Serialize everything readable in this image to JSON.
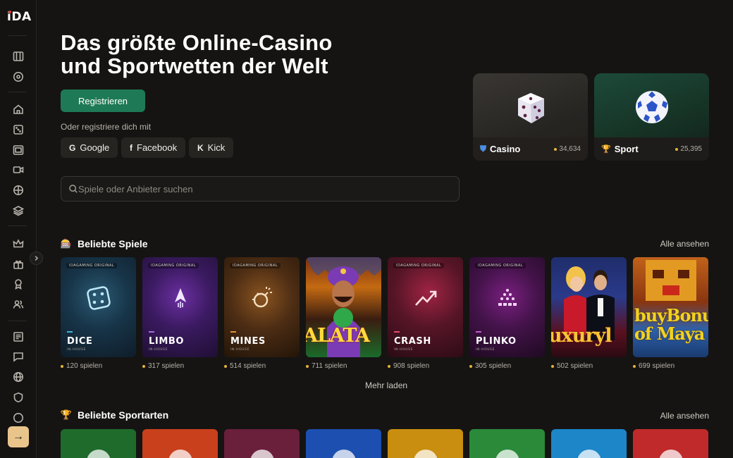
{
  "brand": {
    "logo": "iDA"
  },
  "sidebar": {
    "icons": [
      "slots-icon",
      "target-icon",
      "home-icon",
      "dice-icon",
      "slot-machine-icon",
      "video-icon",
      "ball-icon",
      "layers-icon",
      "crown-icon",
      "gift-icon",
      "award-icon",
      "users-icon",
      "news-icon",
      "chat-icon",
      "globe-icon",
      "shield-icon",
      "support-icon"
    ],
    "collapse": "chevron-right-icon",
    "login": "→"
  },
  "hero": {
    "title": "Das größte Online-Casino und Sportwetten der Welt",
    "register_label": "Registrieren",
    "register_with": "Oder registriere dich mit",
    "social": [
      {
        "glyph": "G",
        "label": "Google"
      },
      {
        "glyph": "f",
        "label": "Facebook"
      },
      {
        "glyph": "K",
        "label": "Kick"
      }
    ]
  },
  "search": {
    "placeholder": "Spiele oder Anbieter suchen"
  },
  "categories": [
    {
      "label": "Casino",
      "count": "34,634",
      "icon": "shield-icon"
    },
    {
      "label": "Sport",
      "count": "25,395",
      "icon": "trophy-icon"
    }
  ],
  "popular_games": {
    "title": "Beliebte Spiele",
    "see_all": "Alle ansehen",
    "load_more": "Mehr laden",
    "items": [
      {
        "tag": "IDAGAMING ORIGINAL",
        "name": "DICE",
        "sub": "IN-HOUSE",
        "plays": "120 spielen"
      },
      {
        "tag": "IDAGAMING ORIGINAL",
        "name": "LIMBO",
        "sub": "IN-HOUSE",
        "plays": "317 spielen"
      },
      {
        "tag": "IDAGAMING ORIGINAL",
        "name": "MINES",
        "sub": "IN-HOUSE",
        "plays": "514 spielen"
      },
      {
        "name": "ALATA",
        "plays": "711 spielen"
      },
      {
        "tag": "IDAGAMING ORIGINAL",
        "name": "CRASH",
        "sub": "IN-HOUSE",
        "plays": "908 spielen"
      },
      {
        "tag": "IDAGAMING ORIGINAL",
        "name": "PLINKO",
        "sub": "IN-HOUSE",
        "plays": "305 spielen"
      },
      {
        "name": "uxuryl",
        "plays": "502 spielen"
      },
      {
        "name": "buyBonu of Maya",
        "plays": "699 spielen"
      }
    ]
  },
  "popular_sports": {
    "title": "Beliebte Sportarten",
    "see_all": "Alle ansehen",
    "colors": [
      "#1f6b2c",
      "#c9401c",
      "#6a1f3b",
      "#1c4fb0",
      "#c98e0f",
      "#2a8a3a",
      "#1c86c9",
      "#c02a2a"
    ]
  }
}
